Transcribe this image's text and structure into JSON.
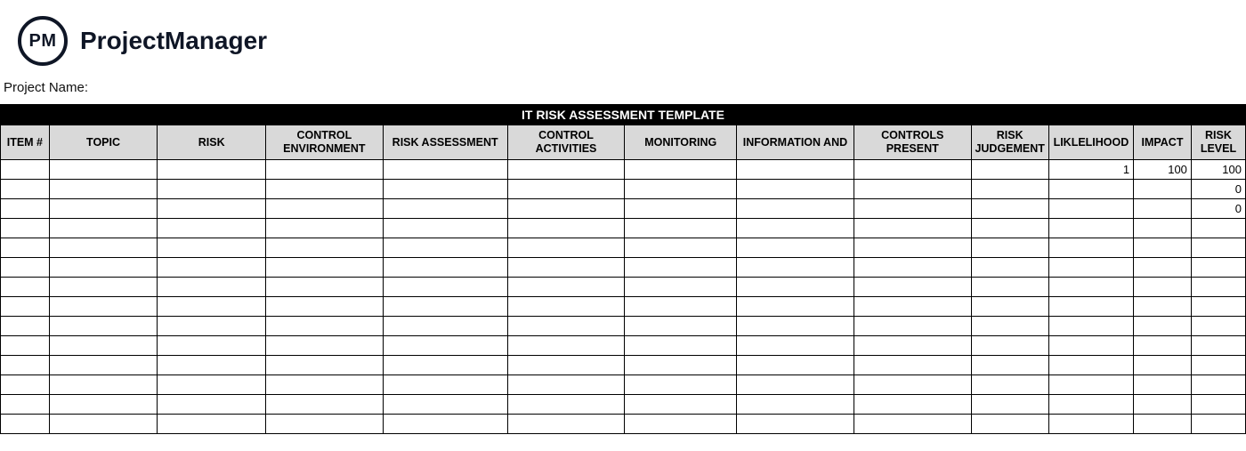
{
  "brand": {
    "logo_initials": "PM",
    "name": "ProjectManager"
  },
  "labels": {
    "project_name": "Project Name:"
  },
  "table": {
    "title": "IT RISK ASSESSMENT TEMPLATE",
    "headers": [
      "ITEM #",
      "TOPIC",
      "RISK",
      "CONTROL ENVIRONMENT",
      "RISK ASSESSMENT",
      "CONTROL ACTIVITIES",
      "MONITORING",
      "INFORMATION AND",
      "CONTROLS PRESENT",
      "RISK JUDGEMENT",
      "LIKLELIHOOD",
      "IMPACT",
      "RISK LEVEL"
    ],
    "rows": [
      {
        "item": "",
        "topic": "",
        "risk": "",
        "ctrlenv": "",
        "riskassess": "",
        "ctrlact": "",
        "monitor": "",
        "info": "",
        "ctrlpres": "",
        "riskjudge": "",
        "likelihood": "1",
        "impact": "100",
        "risklevel": "100"
      },
      {
        "item": "",
        "topic": "",
        "risk": "",
        "ctrlenv": "",
        "riskassess": "",
        "ctrlact": "",
        "monitor": "",
        "info": "",
        "ctrlpres": "",
        "riskjudge": "",
        "likelihood": "",
        "impact": "",
        "risklevel": "0"
      },
      {
        "item": "",
        "topic": "",
        "risk": "",
        "ctrlenv": "",
        "riskassess": "",
        "ctrlact": "",
        "monitor": "",
        "info": "",
        "ctrlpres": "",
        "riskjudge": "",
        "likelihood": "",
        "impact": "",
        "risklevel": "0"
      },
      {
        "item": "",
        "topic": "",
        "risk": "",
        "ctrlenv": "",
        "riskassess": "",
        "ctrlact": "",
        "monitor": "",
        "info": "",
        "ctrlpres": "",
        "riskjudge": "",
        "likelihood": "",
        "impact": "",
        "risklevel": ""
      },
      {
        "item": "",
        "topic": "",
        "risk": "",
        "ctrlenv": "",
        "riskassess": "",
        "ctrlact": "",
        "monitor": "",
        "info": "",
        "ctrlpres": "",
        "riskjudge": "",
        "likelihood": "",
        "impact": "",
        "risklevel": ""
      },
      {
        "item": "",
        "topic": "",
        "risk": "",
        "ctrlenv": "",
        "riskassess": "",
        "ctrlact": "",
        "monitor": "",
        "info": "",
        "ctrlpres": "",
        "riskjudge": "",
        "likelihood": "",
        "impact": "",
        "risklevel": ""
      },
      {
        "item": "",
        "topic": "",
        "risk": "",
        "ctrlenv": "",
        "riskassess": "",
        "ctrlact": "",
        "monitor": "",
        "info": "",
        "ctrlpres": "",
        "riskjudge": "",
        "likelihood": "",
        "impact": "",
        "risklevel": ""
      },
      {
        "item": "",
        "topic": "",
        "risk": "",
        "ctrlenv": "",
        "riskassess": "",
        "ctrlact": "",
        "monitor": "",
        "info": "",
        "ctrlpres": "",
        "riskjudge": "",
        "likelihood": "",
        "impact": "",
        "risklevel": ""
      },
      {
        "item": "",
        "topic": "",
        "risk": "",
        "ctrlenv": "",
        "riskassess": "",
        "ctrlact": "",
        "monitor": "",
        "info": "",
        "ctrlpres": "",
        "riskjudge": "",
        "likelihood": "",
        "impact": "",
        "risklevel": ""
      },
      {
        "item": "",
        "topic": "",
        "risk": "",
        "ctrlenv": "",
        "riskassess": "",
        "ctrlact": "",
        "monitor": "",
        "info": "",
        "ctrlpres": "",
        "riskjudge": "",
        "likelihood": "",
        "impact": "",
        "risklevel": ""
      },
      {
        "item": "",
        "topic": "",
        "risk": "",
        "ctrlenv": "",
        "riskassess": "",
        "ctrlact": "",
        "monitor": "",
        "info": "",
        "ctrlpres": "",
        "riskjudge": "",
        "likelihood": "",
        "impact": "",
        "risklevel": ""
      },
      {
        "item": "",
        "topic": "",
        "risk": "",
        "ctrlenv": "",
        "riskassess": "",
        "ctrlact": "",
        "monitor": "",
        "info": "",
        "ctrlpres": "",
        "riskjudge": "",
        "likelihood": "",
        "impact": "",
        "risklevel": ""
      },
      {
        "item": "",
        "topic": "",
        "risk": "",
        "ctrlenv": "",
        "riskassess": "",
        "ctrlact": "",
        "monitor": "",
        "info": "",
        "ctrlpres": "",
        "riskjudge": "",
        "likelihood": "",
        "impact": "",
        "risklevel": ""
      },
      {
        "item": "",
        "topic": "",
        "risk": "",
        "ctrlenv": "",
        "riskassess": "",
        "ctrlact": "",
        "monitor": "",
        "info": "",
        "ctrlpres": "",
        "riskjudge": "",
        "likelihood": "",
        "impact": "",
        "risklevel": ""
      }
    ]
  }
}
